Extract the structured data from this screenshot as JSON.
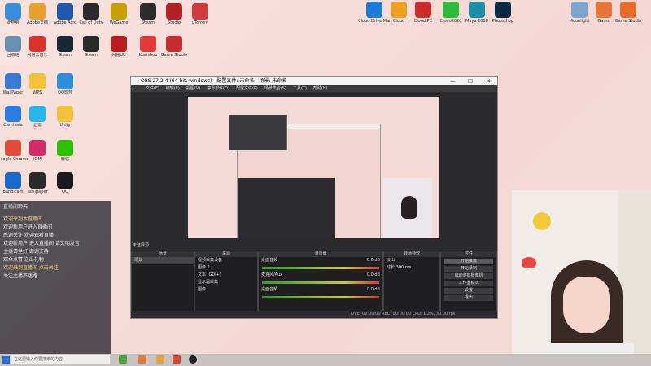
{
  "desktop_icons_left": [
    {
      "label": "此电脑",
      "color": "#3b8ede"
    },
    {
      "label": "Adobe文档",
      "color": "#e8a12a"
    },
    {
      "label": "Adobe Acro",
      "color": "#1e5bb0"
    },
    {
      "label": "Call of Duty",
      "color": "#2b2b2b"
    },
    {
      "label": "WeGame",
      "color": "#c8a000"
    },
    {
      "label": "Steam",
      "color": "#2c2c2c"
    },
    {
      "label": "Studio",
      "color": "#b32222"
    },
    {
      "label": "uTorrent",
      "color": "#cf3b3b"
    },
    {
      "label": "回收站",
      "color": "#6a8fb0"
    },
    {
      "label": "网易云音乐",
      "color": "#d9342b"
    },
    {
      "label": "Steam",
      "color": "#1b2838"
    },
    {
      "label": "Steam",
      "color": "#2a2a2a"
    },
    {
      "label": "网易UU",
      "color": "#b51f1f"
    },
    {
      "label": "Kuaishou",
      "color": "#e03a3a"
    },
    {
      "label": "Game Studio",
      "color": "#c52f2f"
    },
    {
      "label": "WallPaper",
      "color": "#3a7bd5"
    },
    {
      "label": "WPS",
      "color": "#f0c23a"
    },
    {
      "label": "QQ影音",
      "color": "#2f8fdc"
    },
    {
      "label": "Camtasia",
      "color": "#2d7de0"
    },
    {
      "label": "迅雷",
      "color": "#2ab5e8"
    },
    {
      "label": "Unity",
      "color": "#f3c13a"
    },
    {
      "label": "Google Chrome",
      "color": "#e04d3a"
    },
    {
      "label": "IDM",
      "color": "#d02b6b"
    },
    {
      "label": "微信",
      "color": "#2dc100"
    },
    {
      "label": "Bandicam",
      "color": "#1a6ad0"
    },
    {
      "label": "Wallpaper",
      "color": "#2b2b2b"
    },
    {
      "label": "QQ",
      "color": "#1a1a1a"
    }
  ],
  "desktop_icons_right": [
    {
      "label": "Cloud Drive Manager",
      "color": "#1d7bd6"
    },
    {
      "label": "Cloud",
      "color": "#f0a020"
    },
    {
      "label": "Cloud PC",
      "color": "#d02b2b"
    },
    {
      "label": "Cloud2020",
      "color": "#2dbb3a"
    },
    {
      "label": "Maya 2018",
      "color": "#1c8fa8"
    },
    {
      "label": "Photoshop",
      "color": "#0a2a44"
    },
    {
      "label": "Moonlight",
      "color": "#7aa6cf"
    },
    {
      "label": "Game",
      "color": "#e8743a"
    },
    {
      "label": "Game Studio",
      "color": "#e86a2a"
    }
  ],
  "chat": {
    "header": "直播间聊天",
    "messages": [
      {
        "text": "欢迎来到本直播间",
        "highlight": true
      },
      {
        "text": "欢迎新用户进入直播间",
        "highlight": false
      },
      {
        "text": "感谢关注 欢迎观看直播",
        "highlight": false
      },
      {
        "text": "欢迎新用户 进入直播间 请文明发言",
        "highlight": false
      },
      {
        "text": "主播请坐好 谢谢支持",
        "highlight": false
      },
      {
        "text": "观众点赞 送出礼物",
        "highlight": false
      },
      {
        "text": "欢迎来到直播间 点击关注",
        "highlight": true
      },
      {
        "text": "关注主播不迷路",
        "highlight": false
      }
    ]
  },
  "taskbar": {
    "search_placeholder": "在这里输入你要搜索的内容"
  },
  "obs": {
    "title": "OBS 27.2.4 (64-bit, windows) - 配置文件: 未命名 - 场景: 未命名",
    "menu": [
      "文件(F)",
      "编辑(E)",
      "视图(V)",
      "停靠部件(D)",
      "配置文件(P)",
      "场景集合(S)",
      "工具(T)",
      "帮助(H)"
    ],
    "no_source": "未选择源",
    "scenes_header": "场景",
    "scene_items": [
      "场景"
    ],
    "sources_header": "来源",
    "source_items": [
      "视频采集设备",
      "图像 2",
      "文本 (GDI+)",
      "显示器采集",
      "图像"
    ],
    "mixer_header": "混音器",
    "mixer_items": [
      {
        "name": "桌面音频",
        "level": "0.0 dB"
      },
      {
        "name": "麦克风/Aux",
        "level": "0.0 dB"
      },
      {
        "name": "桌面音频",
        "level": "0.0 dB"
      }
    ],
    "transitions_header": "转场特效",
    "transition_value": "淡出",
    "duration_label": "时长",
    "duration_value": "300 ms",
    "controls_header": "控件",
    "controls": [
      "开始推流",
      "开始录制",
      "启动虚拟摄像机",
      "工作室模式",
      "设置",
      "退出"
    ],
    "status": "LIVE: 00:00:00   REC: 00:00:00   CPU: 1.2%, 30.00 fps"
  }
}
